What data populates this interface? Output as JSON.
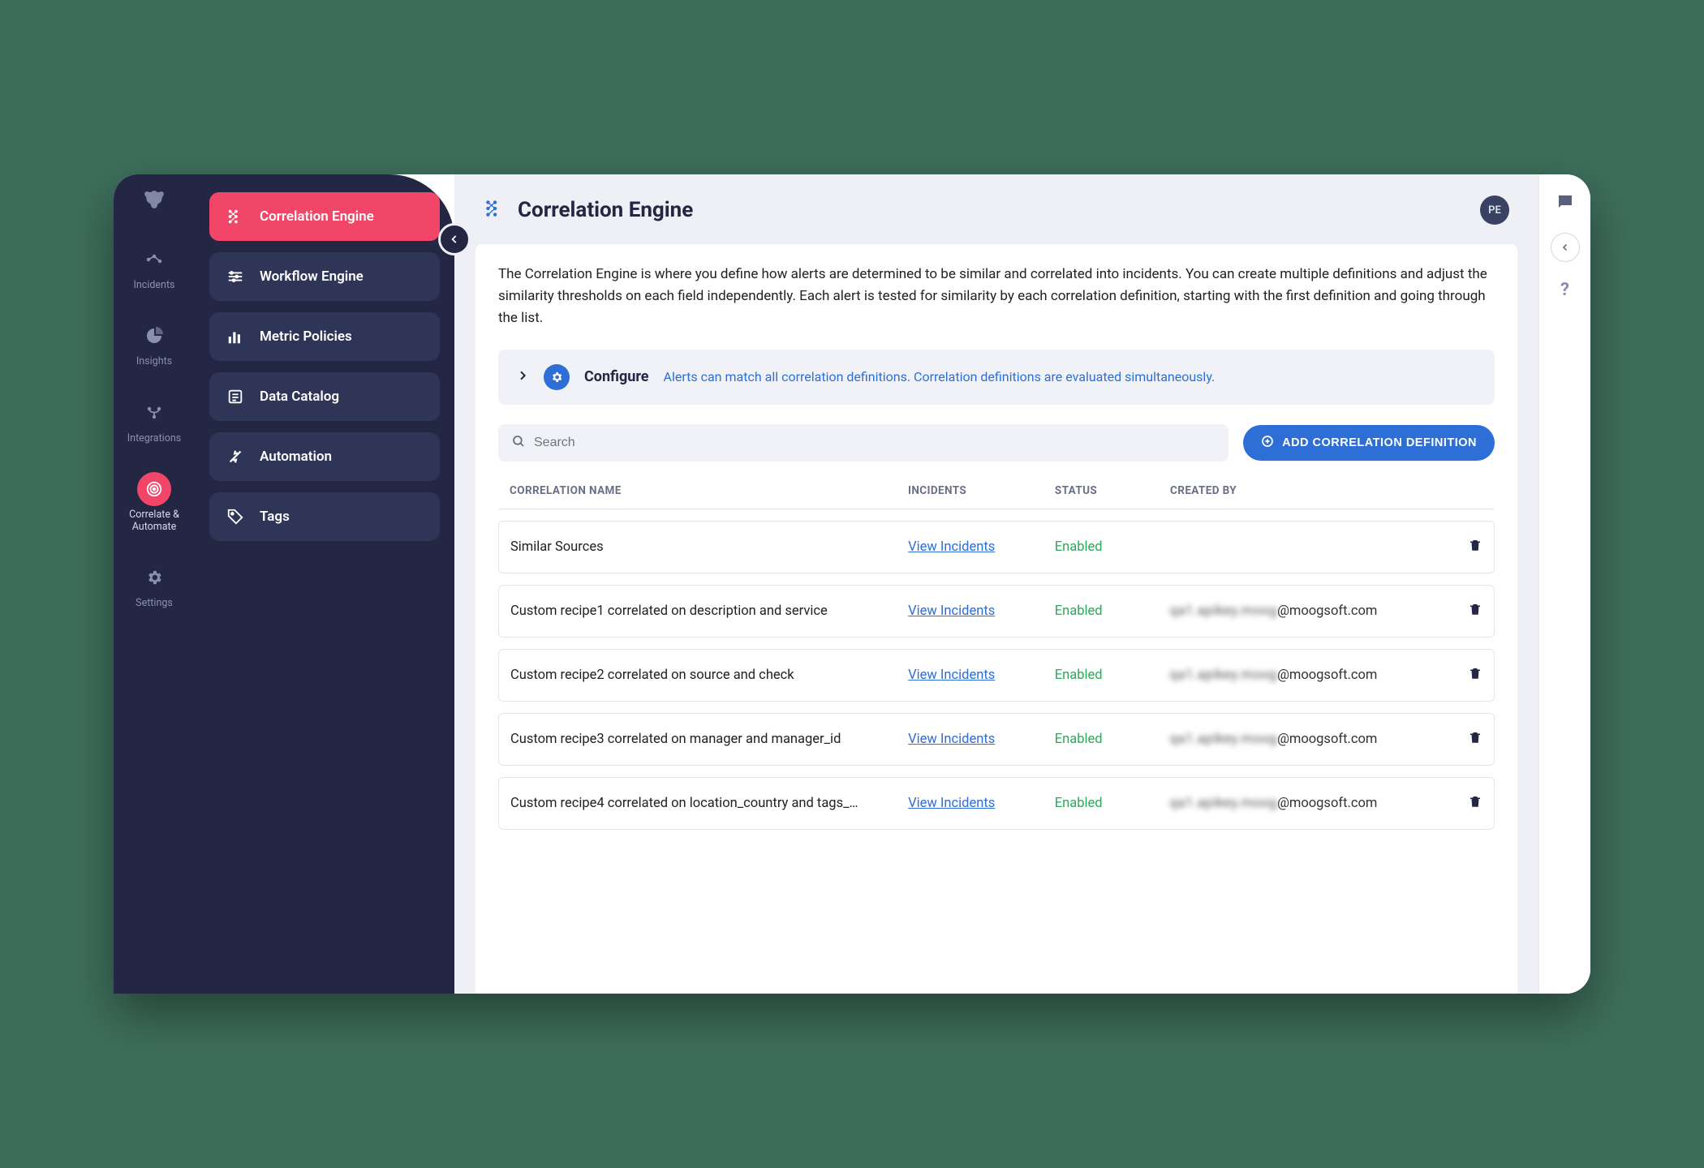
{
  "rail": {
    "items": [
      {
        "label": "Incidents"
      },
      {
        "label": "Insights"
      },
      {
        "label": "Integrations"
      },
      {
        "label": "Correlate & Automate"
      },
      {
        "label": "Settings"
      }
    ]
  },
  "subnav": {
    "items": [
      {
        "label": "Correlation Engine"
      },
      {
        "label": "Workflow Engine"
      },
      {
        "label": "Metric Policies"
      },
      {
        "label": "Data Catalog"
      },
      {
        "label": "Automation"
      },
      {
        "label": "Tags"
      }
    ]
  },
  "header": {
    "title": "Correlation Engine",
    "avatar": "PE"
  },
  "description": "The Correlation Engine is where you define how alerts are determined to be similar and correlated into incidents. You can create multiple definitions and adjust the similarity thresholds on each field independently. Each alert is tested for similarity by each correlation definition, starting with the first definition and going through the list.",
  "configure": {
    "label": "Configure",
    "message": "Alerts can match all correlation definitions. Correlation definitions are evaluated simultaneously."
  },
  "search": {
    "placeholder": "Search"
  },
  "add_button": "ADD CORRELATION DEFINITION",
  "table": {
    "headers": {
      "name": "CORRELATION NAME",
      "incidents": "INCIDENTS",
      "status": "STATUS",
      "created_by": "CREATED BY"
    },
    "view_label": "View Incidents",
    "rows": [
      {
        "name": "Similar Sources",
        "status": "Enabled",
        "creator_obscured": "",
        "creator_domain": ""
      },
      {
        "name": "Custom recipe1 correlated on description and service",
        "status": "Enabled",
        "creator_obscured": "qa1.apikey.moog",
        "creator_domain": "@moogsoft.com"
      },
      {
        "name": "Custom recipe2 correlated on source and check",
        "status": "Enabled",
        "creator_obscured": "qa1.apikey.moog",
        "creator_domain": "@moogsoft.com"
      },
      {
        "name": "Custom recipe3 correlated on manager and manager_id",
        "status": "Enabled",
        "creator_obscured": "qa1.apikey.moog",
        "creator_domain": "@moogsoft.com"
      },
      {
        "name": "Custom recipe4 correlated on location_country and tags_…",
        "status": "Enabled",
        "creator_obscured": "qa1.apikey.moog",
        "creator_domain": "@moogsoft.com"
      }
    ]
  }
}
